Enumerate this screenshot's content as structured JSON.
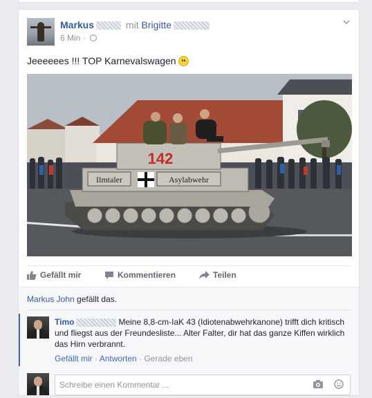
{
  "post": {
    "author": "Markus",
    "with_text": "mit",
    "tagged_friend": "Brigitte",
    "timestamp": "6 Min",
    "separator": "·",
    "text": "Jeeeeees !!! TOP Karnevalswagen",
    "photo": {
      "turret_number": "142",
      "hull_left_text": "Ilmtaler",
      "hull_right_text": "Asylabwehr"
    }
  },
  "actions": {
    "like": "Gefällt mir",
    "comment": "Kommentieren",
    "share": "Teilen"
  },
  "likes": {
    "liker": "Markus John",
    "suffix": "gefällt das."
  },
  "comment": {
    "author": "Timo",
    "text": "Meine 8,8-cm-IaK 43 (Idiotenabwehrkanone) trifft dich kritisch und fliegst aus der Freundesliste... Alter Falter, dir hat das ganze Kiffen wirklich das Hirn verbrannt.",
    "like_link": "Gefällt mir",
    "reply_link": "Antworten",
    "time": "Gerade eben",
    "separator": "·"
  },
  "reply": {
    "placeholder": "Schreibe einen Kommentar ..."
  },
  "colors": {
    "link": "#365899",
    "accent": "#4267b2",
    "muted": "#90949c",
    "background": "#e9ebee"
  },
  "icons": [
    "globe-icon",
    "chevron-down-icon",
    "smiley-emoji",
    "thumbs-up-icon",
    "comment-icon",
    "share-icon",
    "camera-icon",
    "emoji-icon"
  ]
}
